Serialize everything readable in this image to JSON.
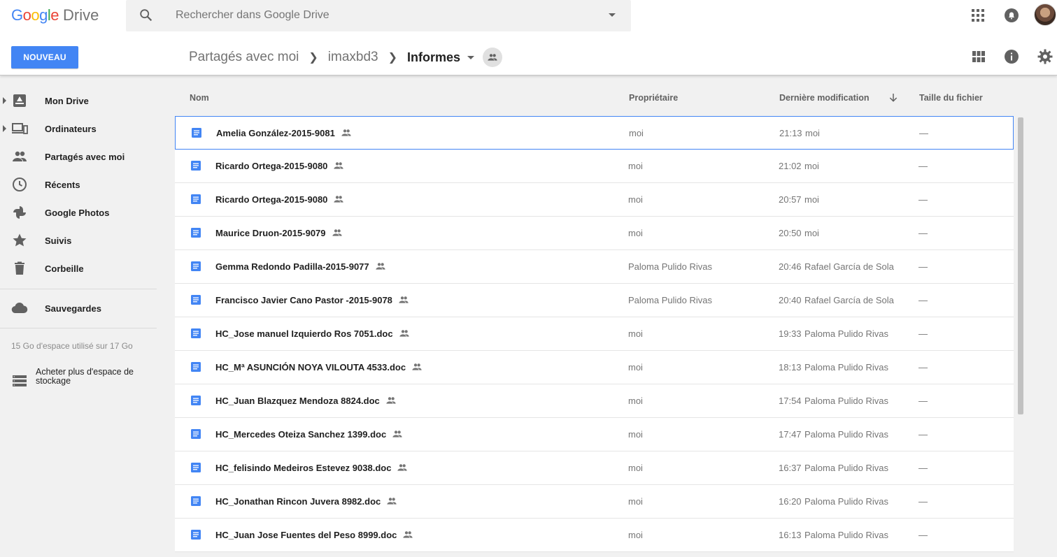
{
  "app": {
    "logo_google": "Google",
    "logo_drive": "Drive"
  },
  "search": {
    "placeholder": "Rechercher dans Google Drive"
  },
  "new_button": "NOUVEAU",
  "breadcrumb": {
    "items": [
      "Partagés avec moi",
      "imaxbd3"
    ],
    "current": "Informes"
  },
  "sidebar": {
    "items": [
      {
        "label": "Mon Drive",
        "icon": "my-drive-icon"
      },
      {
        "label": "Ordinateurs",
        "icon": "computers-icon"
      },
      {
        "label": "Partagés avec moi",
        "icon": "shared-icon"
      },
      {
        "label": "Récents",
        "icon": "clock-icon"
      },
      {
        "label": "Google Photos",
        "icon": "photos-icon"
      },
      {
        "label": "Suivis",
        "icon": "star-icon"
      },
      {
        "label": "Corbeille",
        "icon": "trash-icon"
      }
    ],
    "backups": "Sauvegardes",
    "storage": "15 Go d'espace utilisé sur 17 Go",
    "buy": "Acheter plus d'espace de stockage"
  },
  "columns": {
    "name": "Nom",
    "owner": "Propriétaire",
    "modified": "Dernière modification",
    "size": "Taille du fichier"
  },
  "files": [
    {
      "name": "Amelia González-2015-9081",
      "owner": "moi",
      "time": "21:13",
      "by": "moi",
      "size": "—"
    },
    {
      "name": "Ricardo Ortega-2015-9080",
      "owner": "moi",
      "time": "21:02",
      "by": "moi",
      "size": "—"
    },
    {
      "name": "Ricardo Ortega-2015-9080",
      "owner": "moi",
      "time": "20:57",
      "by": "moi",
      "size": "—"
    },
    {
      "name": "Maurice Druon-2015-9079",
      "owner": "moi",
      "time": "20:50",
      "by": "moi",
      "size": "—"
    },
    {
      "name": "Gemma Redondo Padilla-2015-9077",
      "owner": "Paloma Pulido Rivas",
      "time": "20:46",
      "by": "Rafael García de Sola",
      "size": "—"
    },
    {
      "name": "Francisco Javier Cano Pastor -2015-9078",
      "owner": "Paloma Pulido Rivas",
      "time": "20:40",
      "by": "Rafael García de Sola",
      "size": "—"
    },
    {
      "name": "HC_Jose manuel Izquierdo Ros 7051.doc",
      "owner": "moi",
      "time": "19:33",
      "by": "Paloma Pulido Rivas",
      "size": "—"
    },
    {
      "name": "HC_Mª ASUNCIÓN NOYA VILOUTA 4533.doc",
      "owner": "moi",
      "time": "18:13",
      "by": "Paloma Pulido Rivas",
      "size": "—"
    },
    {
      "name": "HC_Juan Blazquez Mendoza 8824.doc",
      "owner": "moi",
      "time": "17:54",
      "by": "Paloma Pulido Rivas",
      "size": "—"
    },
    {
      "name": "HC_Mercedes Oteiza Sanchez 1399.doc",
      "owner": "moi",
      "time": "17:47",
      "by": "Paloma Pulido Rivas",
      "size": "—"
    },
    {
      "name": "HC_felisindo Medeiros Estevez 9038.doc",
      "owner": "moi",
      "time": "16:37",
      "by": "Paloma Pulido Rivas",
      "size": "—"
    },
    {
      "name": "HC_Jonathan Rincon Juvera 8982.doc",
      "owner": "moi",
      "time": "16:20",
      "by": "Paloma Pulido Rivas",
      "size": "—"
    },
    {
      "name": "HC_Juan Jose Fuentes del Peso 8999.doc",
      "owner": "moi",
      "time": "16:13",
      "by": "Paloma Pulido Rivas",
      "size": "—"
    }
  ],
  "colors": {
    "accent": "#4285f4",
    "doc_icon": "#4285f4"
  }
}
